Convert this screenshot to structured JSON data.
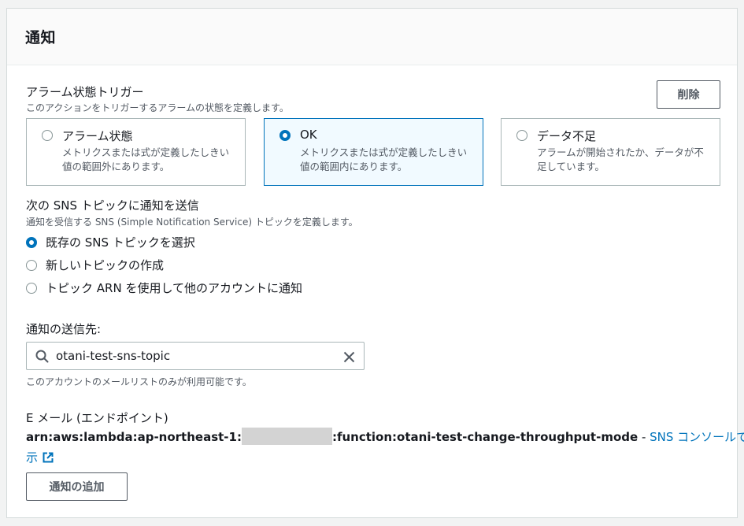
{
  "panel": {
    "title": "通知"
  },
  "alarm_trigger": {
    "label": "アラーム状態トリガー",
    "description": "このアクションをトリガーするアラームの状態を定義します。",
    "remove_button": "削除",
    "options": [
      {
        "label": "アラーム状態",
        "description": "メトリクスまたは式が定義したしきい値の範囲外にあります。",
        "selected": false
      },
      {
        "label": "OK",
        "description": "メトリクスまたは式が定義したしきい値の範囲内にあります。",
        "selected": true
      },
      {
        "label": "データ不足",
        "description": "アラームが開始されたか、データが不足しています。",
        "selected": false
      }
    ]
  },
  "sns": {
    "label": "次の SNS トピックに通知を送信",
    "description": "通知を受信する SNS (Simple Notification Service) トピックを定義します。",
    "options": [
      {
        "label": "既存の SNS トピックを選択",
        "selected": true
      },
      {
        "label": "新しいトピックの作成",
        "selected": false
      },
      {
        "label": "トピック ARN を使用して他のアカウントに通知",
        "selected": false
      }
    ]
  },
  "destination": {
    "label": "通知の送信先:",
    "value": "otani-test-sns-topic",
    "hint": "このアカウントのメールリストのみが利用可能です。"
  },
  "endpoint": {
    "label": "E メール (エンドポイント)",
    "arn_prefix": "arn:aws:lambda:ap-northeast-1:",
    "arn_suffix": ":function:otani-test-change-throughput-mode",
    "separator": " - ",
    "link_line1": "SNS コンソールで表",
    "link_line2": "示"
  },
  "add_button": "通知の追加",
  "colors": {
    "accent": "#0073bb",
    "border": "#aab7b8",
    "selected_bg": "#f1faff"
  }
}
